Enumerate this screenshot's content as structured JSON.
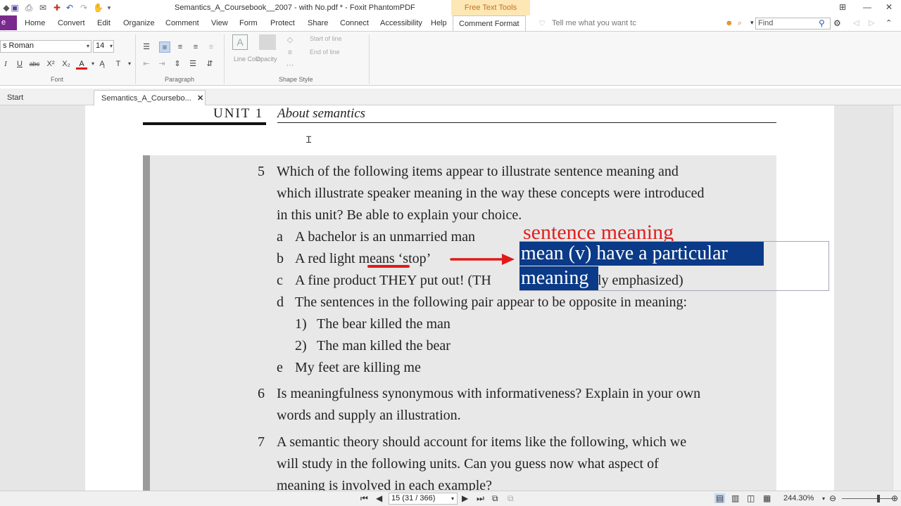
{
  "window": {
    "title": "Semantics_A_Coursebook__2007 - with No.pdf * - Foxit PhantomPDF",
    "context_tab": "Free Text Tools"
  },
  "ribbon_tabs": [
    "Home",
    "Convert",
    "Edit",
    "Organize",
    "Comment",
    "View",
    "Form",
    "Protect",
    "Share",
    "Connect",
    "Accessibility",
    "Help",
    "Comment Format"
  ],
  "file_tab": "e",
  "tell_me": "Tell me what you want tc",
  "find": {
    "placeholder": "Find"
  },
  "ribbon": {
    "font_name": "s Roman",
    "font_size": "14",
    "font_group": "Font",
    "paragraph_group": "Paragraph",
    "shape_style_group": "Shape Style",
    "line_color": "Line Color",
    "opacity": "Opacity",
    "start_of_line": "Start of line",
    "end_of_line": "End of line"
  },
  "doc_tabs": [
    {
      "label": "Start"
    },
    {
      "label": "Semantics_A_Coursebo..."
    }
  ],
  "page": {
    "unit_label": "UNIT 1",
    "unit_title": "About semantics",
    "q5_num": "5",
    "q5_lines": [
      "Which of the following items appear to illustrate sentence meaning and",
      "which illustrate speaker meaning in the way these concepts were introduced",
      "in this unit? Be able to explain your choice."
    ],
    "items": [
      {
        "letter": "a",
        "text": "A bachelor is an unmarried man"
      },
      {
        "letter": "b",
        "text": "A red light means ‘stop’"
      },
      {
        "letter": "c",
        "text": "A fine product THEY put out! (TH"
      },
      {
        "letter": "d",
        "text": "The sentences in the following pair appear to be opposite in meaning:"
      },
      {
        "letter": "e",
        "text": "My feet are killing me"
      }
    ],
    "item_c_tail": "ly emphasized)",
    "sub_items": [
      {
        "num": "1)",
        "text": "The bear killed the man"
      },
      {
        "num": "2)",
        "text": "The man killed the bear"
      }
    ],
    "q6_num": "6",
    "q6_lines": [
      "Is meaningfulness synonymous with informativeness? Explain in your own",
      "words and supply an illustration."
    ],
    "q7_num": "7",
    "q7_lines": [
      "A semantic theory should account for items like the following, which we",
      "will study in the following units. Can you guess now what aspect of",
      "meaning is involved in each example?"
    ]
  },
  "annotations": {
    "red_note": "sentence meaning",
    "highlight_line1": "mean (v) have a particular",
    "highlight_line2": "meaning",
    "colors": {
      "red": "#e0201e",
      "highlight": "#0a3a88"
    }
  },
  "status": {
    "page_indicator": "15 (31 / 366)",
    "zoom": "244.30%"
  }
}
